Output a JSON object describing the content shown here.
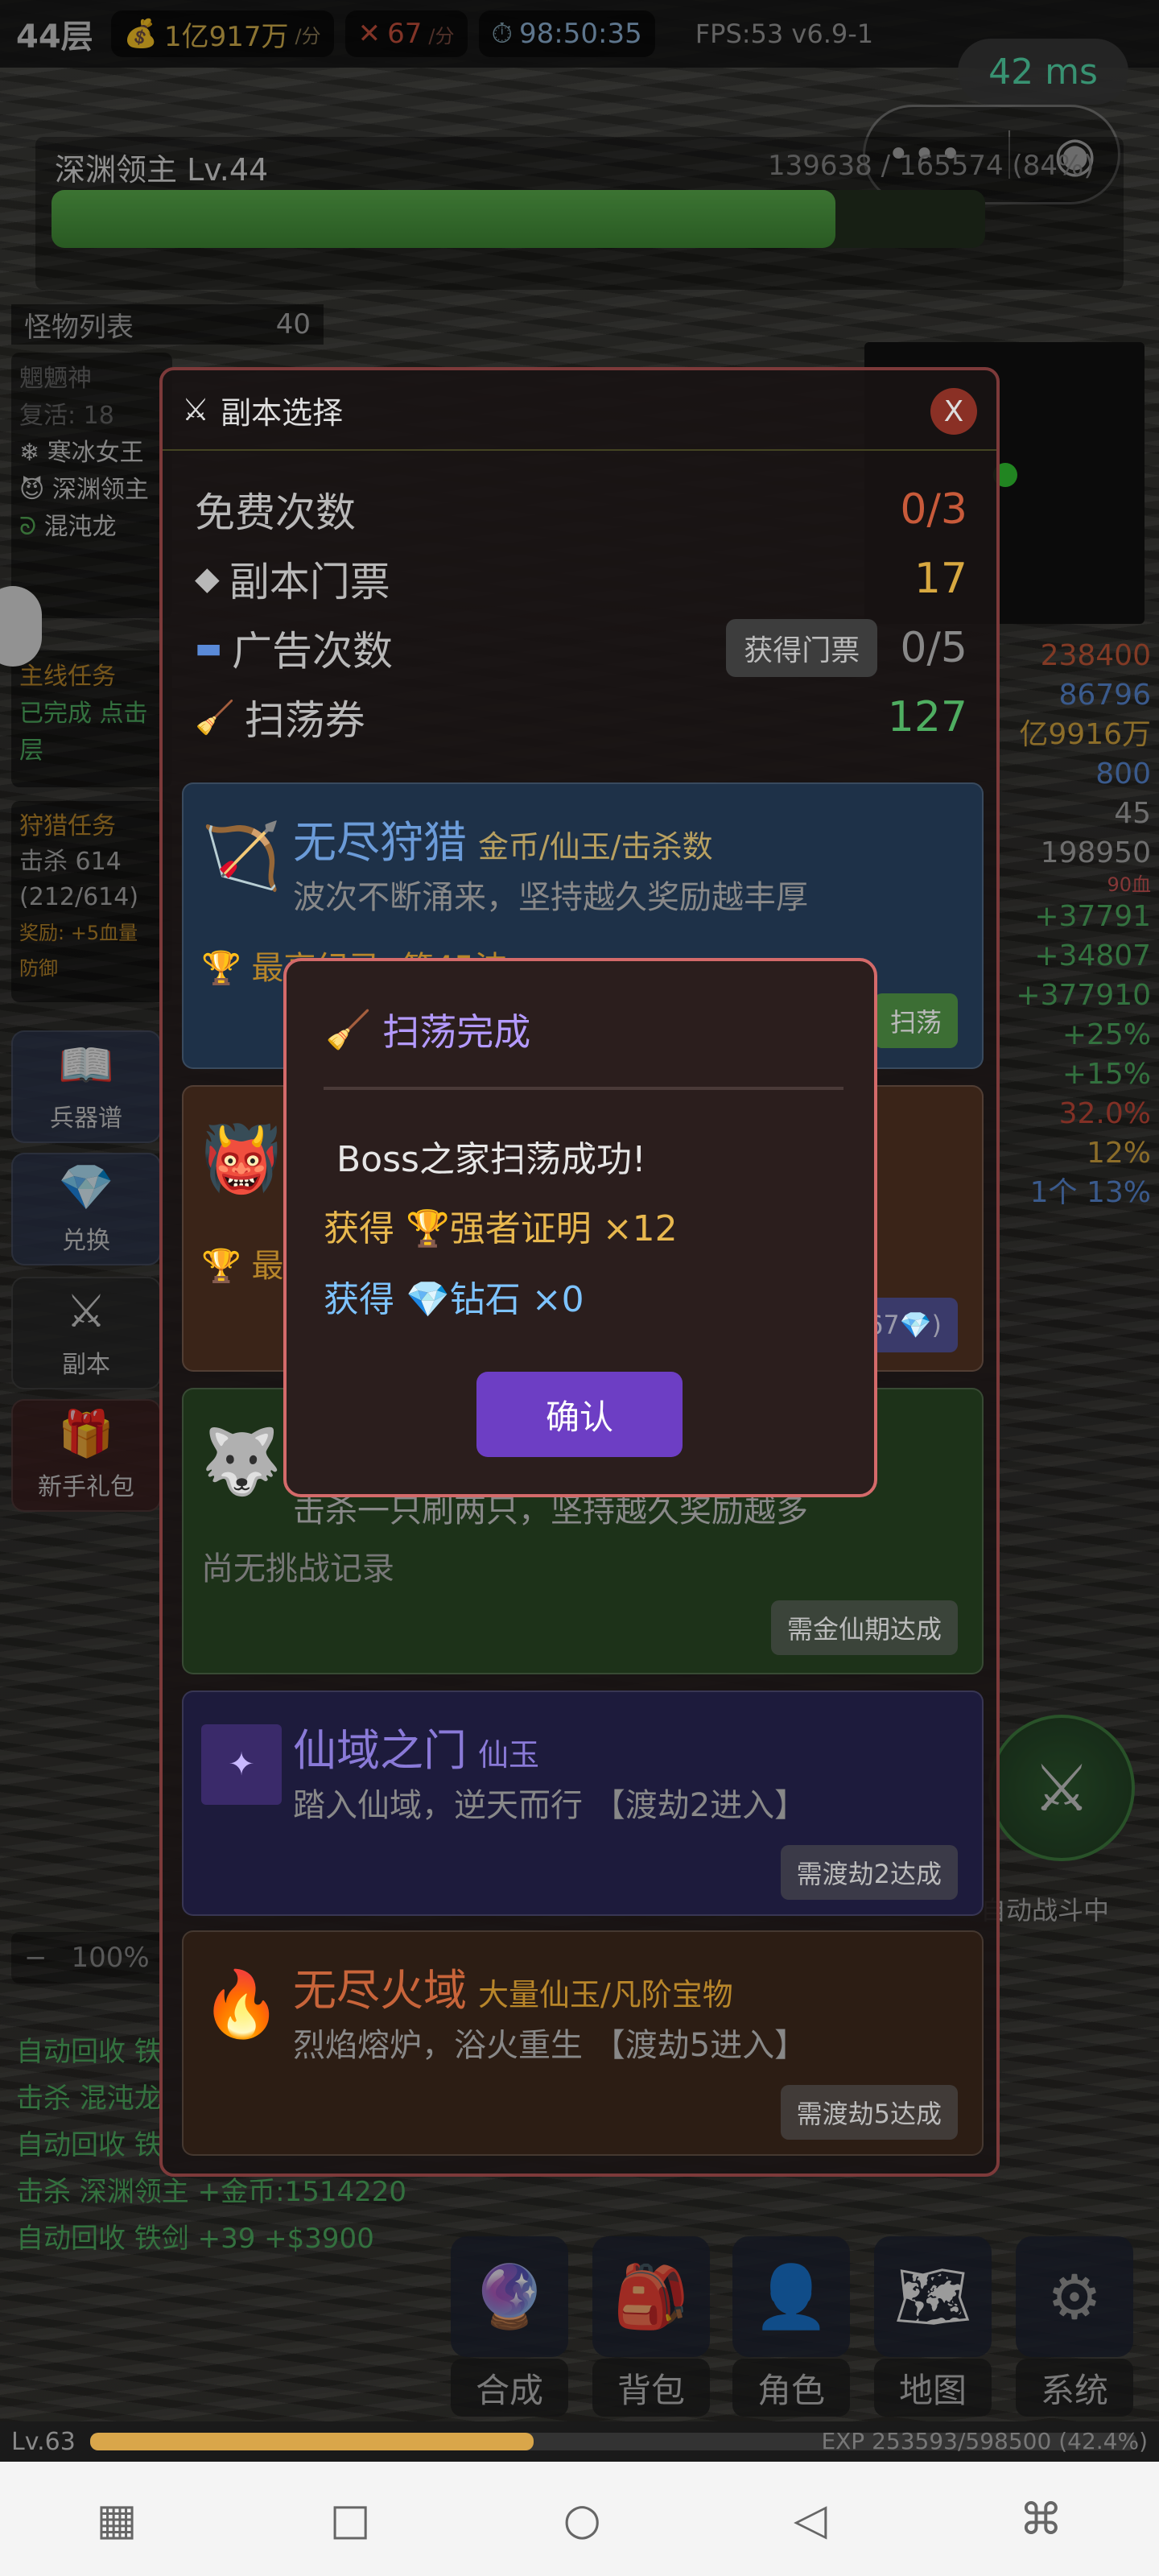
{
  "status": {
    "floor": "44层",
    "gold": "1亿917万",
    "gold_unit": "/分",
    "kills": "67",
    "kills_unit": "/分",
    "timer": "98:50:35",
    "fps": "FPS:53 v6.9-1",
    "ping": "42 ms"
  },
  "boss": {
    "name": "深渊领主 Lv.44",
    "hp_text": "139638 / 165574 (84%)",
    "hp_fraction": 0.84
  },
  "left_panel": {
    "monster_list_label": "怪物列表",
    "monster_count": "40",
    "monsters": [
      "魍魉神",
      "复活: 18",
      "寒冰女王",
      "深渊领主",
      "混沌龙"
    ],
    "main_task": "主线任务",
    "main_task_status": "已完成 点击",
    "main_task_floor": "层",
    "hunt_task": "狩猎任务",
    "hunt_kills": "击杀 614",
    "hunt_progress": "(212/614)",
    "hunt_reward": "奖励: +5血量",
    "hunt_reward2": "防御",
    "buttons": [
      "兵器谱",
      "兑换",
      "副本",
      "新手礼包"
    ]
  },
  "right_stats": [
    "238400",
    "86796",
    "亿9916万",
    "800",
    "45",
    "198950",
    "90血",
    "+37791",
    "+34807",
    "+377910",
    "+25%",
    "+15%",
    "32.0%",
    "12%",
    "1个 13%"
  ],
  "dungeon_select": {
    "title": "副本选择",
    "close": "X",
    "free_label": "免费次数",
    "free_value": "0/3",
    "ticket_label": "副本门票",
    "ticket_value": "17",
    "ad_label": "广告次数",
    "ad_button": "获得门票",
    "ad_value": "0/5",
    "sweep_label": "扫荡券",
    "sweep_value": "127",
    "cards": [
      {
        "title": "无尽狩猎",
        "tag": "金币/仙玉/击杀数",
        "desc": "波次不断涌来，坚持越久奖励越丰厚",
        "record": "最高纪录: 第45波",
        "button": "扫荡"
      },
      {
        "title": "",
        "tag": "",
        "desc": "",
        "record": "最",
        "button": "67💎)"
      },
      {
        "title": "",
        "tag": "",
        "desc": "击杀一只刷两只，坚持越久奖励越多",
        "record": "尚无挑战记录",
        "button": "需金仙期达成"
      },
      {
        "title": "仙域之门",
        "tag": "仙玉",
        "desc": "踏入仙域，逆天而行 【渡劫2进入】",
        "record": "",
        "button": "需渡劫2达成"
      },
      {
        "title": "无尽火域",
        "tag": "大量仙玉/凡阶宝物",
        "desc": "烈焰熔炉，浴火重生 【渡劫5进入】",
        "record": "",
        "button": "需渡劫5达成"
      }
    ]
  },
  "popup": {
    "title": "扫荡完成",
    "message": "Boss之家扫荡成功!",
    "reward1": "获得 🏆强者证明 ×12",
    "reward2": "获得 💎钻石 ×0",
    "confirm": "确认"
  },
  "zoom": {
    "minus": "−",
    "value": "100%"
  },
  "log": [
    "自动回收 铁",
    "击杀 混沌龙",
    "自动回收 铁",
    "击杀 深渊领主 +金币:1514220",
    "自动回收 铁剑 +39 +$3900"
  ],
  "auto_battle": "自动战斗中",
  "bottom_menu": [
    "合成",
    "背包",
    "角色",
    "地图",
    "系统"
  ],
  "level": {
    "label": "Lv.63",
    "exp": "EXP 253593/598500 (42.4%)",
    "fraction": 0.424
  },
  "nav_icons": [
    "apps-icon",
    "recent-icon",
    "home-icon",
    "back-icon",
    "ai-icon"
  ]
}
